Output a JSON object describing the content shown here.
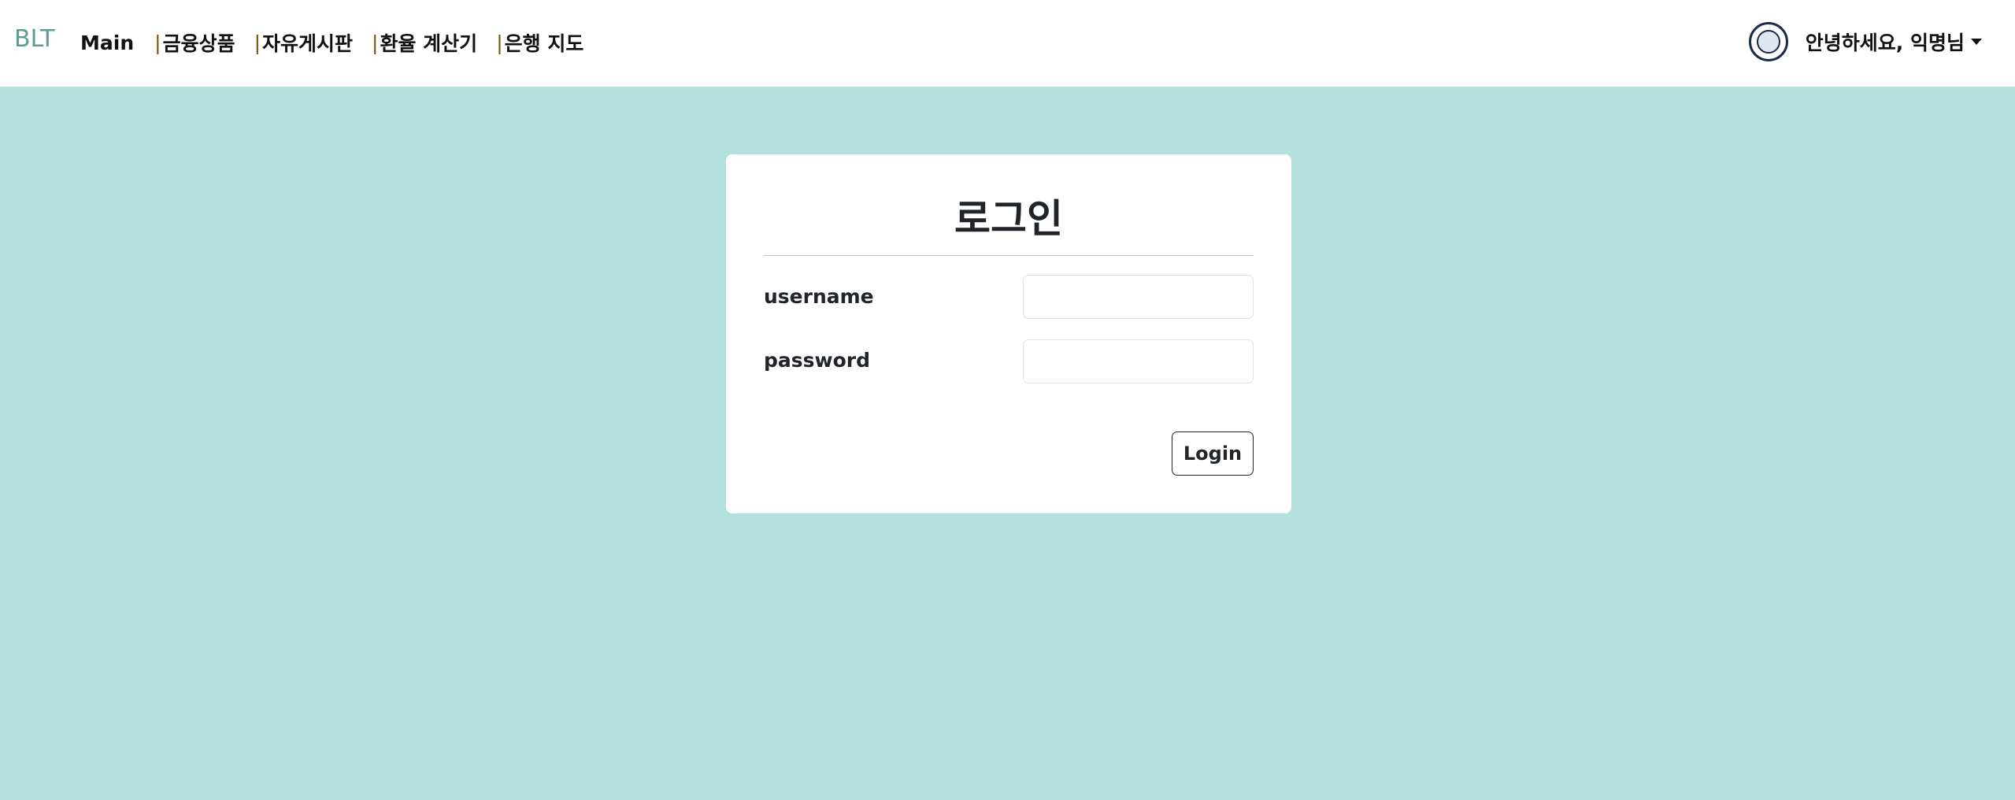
{
  "navbar": {
    "brand": "BLT",
    "main_link": "Main",
    "separator": "|",
    "links": [
      "금융상품",
      "자유게시판",
      "환율 계산기",
      "은행 지도"
    ],
    "greeting": "안녕하세요, 익명님",
    "avatar_icon": "avatar-logo-icon",
    "caret_icon": "caret-down-icon"
  },
  "login": {
    "title": "로그인",
    "username_label": "username",
    "password_label": "password",
    "username_value": "",
    "password_value": "",
    "button_label": "Login"
  },
  "colors": {
    "background": "#b3dfdc",
    "brand": "#5c9c97",
    "card": "#ffffff",
    "text": "#212529"
  }
}
